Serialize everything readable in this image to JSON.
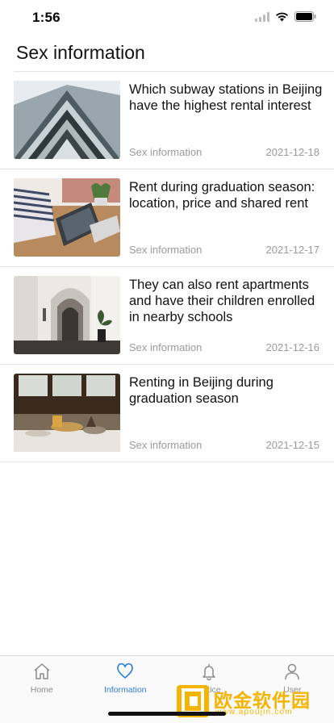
{
  "status": {
    "time": "1:56"
  },
  "header": {
    "title": "Sex information"
  },
  "articles": [
    {
      "title": "Which subway stations in Beijing have the highest rental interest",
      "category": "Sex information",
      "date": "2021-12-18",
      "thumb": "building-icon"
    },
    {
      "title": "Rent during graduation season: location, price and shared rent",
      "category": "Sex information",
      "date": "2021-12-17",
      "thumb": "laptop-icon"
    },
    {
      "title": "They can also rent apartments and have their children enrolled in nearby schools",
      "category": "Sex information",
      "date": "2021-12-16",
      "thumb": "hallway-icon"
    },
    {
      "title": "Renting in Beijing during graduation season",
      "category": "Sex information",
      "date": "2021-12-15",
      "thumb": "table-icon"
    }
  ],
  "tabs": [
    {
      "label": "Home",
      "icon": "home-icon",
      "active": false
    },
    {
      "label": "Information",
      "icon": "heart-icon",
      "active": true
    },
    {
      "label": "Notice",
      "icon": "bell-icon",
      "active": false
    },
    {
      "label": "User",
      "icon": "user-icon",
      "active": false
    }
  ],
  "watermark": {
    "text": "欧金软件园",
    "url": "www.apoujin.com"
  },
  "colors": {
    "accent": "#2a7ed8",
    "muted": "#9a9a9a",
    "watermark": "#f5b400"
  }
}
